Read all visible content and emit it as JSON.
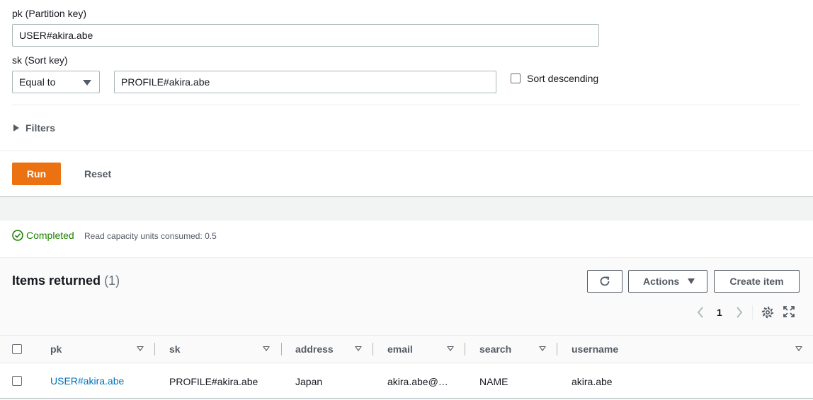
{
  "query": {
    "pk_label": "pk (Partition key)",
    "pk_value": "USER#akira.abe",
    "sk_label": "sk (Sort key)",
    "sk_operator": "Equal to",
    "sk_value": "PROFILE#akira.abe",
    "sort_descending_label": "Sort descending",
    "filters_label": "Filters",
    "run_label": "Run",
    "reset_label": "Reset"
  },
  "status": {
    "state": "Completed",
    "detail": "Read capacity units consumed: 0.5"
  },
  "results": {
    "title": "Items returned",
    "count": "(1)",
    "actions_label": "Actions",
    "create_item_label": "Create item",
    "page_number": "1",
    "columns": [
      "pk",
      "sk",
      "address",
      "email",
      "search",
      "username"
    ],
    "rows": [
      {
        "pk": "USER#akira.abe",
        "sk": "PROFILE#akira.abe",
        "address": "Japan",
        "email": "akira.abe@…",
        "search": "NAME",
        "username": "akira.abe"
      }
    ]
  },
  "colors": {
    "accent": "#ec7211",
    "success": "#1d8102",
    "link": "#0073bb"
  },
  "icons": [
    "check-circle-icon",
    "refresh-icon",
    "caret-right-icon",
    "caret-down-icon",
    "chevron-left-icon",
    "chevron-right-icon",
    "gear-icon",
    "fullscreen-icon",
    "sort-icon"
  ]
}
